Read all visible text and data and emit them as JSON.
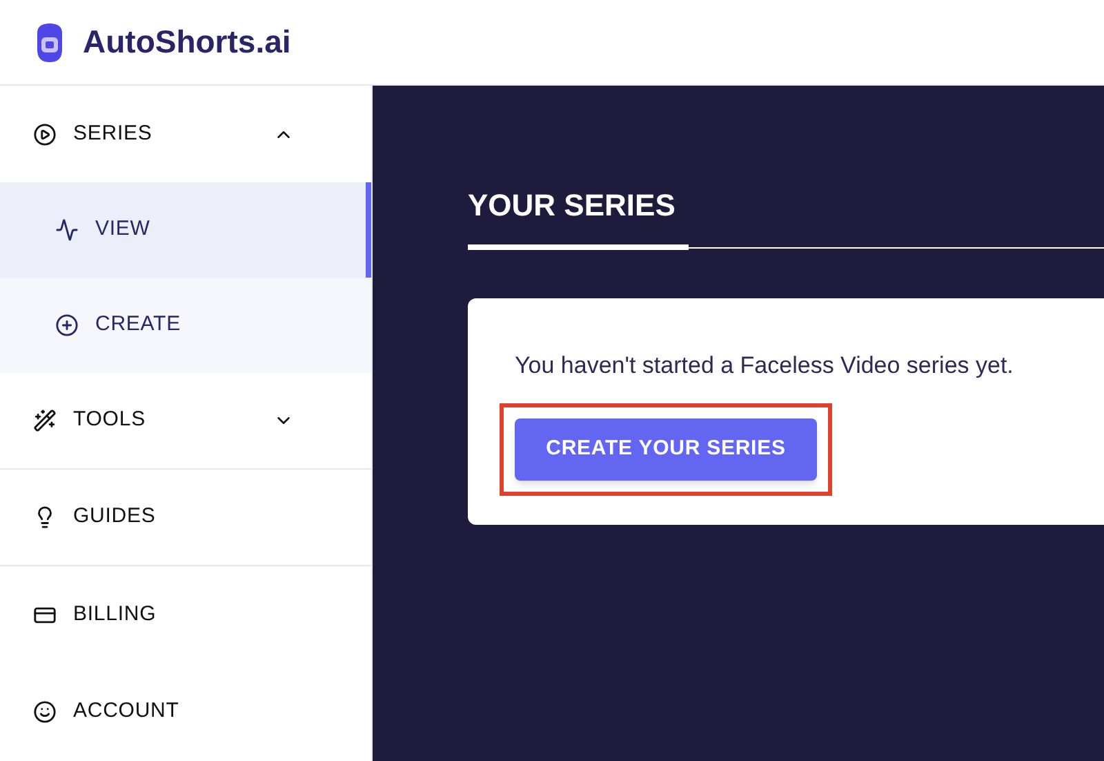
{
  "brand": {
    "name": "AutoShorts.ai"
  },
  "sidebar": {
    "items": [
      {
        "label": "SERIES",
        "expanded": true,
        "children": [
          {
            "label": "VIEW",
            "selected": true
          },
          {
            "label": "CREATE",
            "selected": false
          }
        ]
      },
      {
        "label": "TOOLS",
        "expanded": false
      },
      {
        "label": "GUIDES"
      },
      {
        "label": "BILLING"
      },
      {
        "label": "ACCOUNT"
      }
    ]
  },
  "main": {
    "tab": "YOUR SERIES",
    "message": "You haven't started a Faceless Video series yet.",
    "button": {
      "label": "CREATE YOUR SERIES",
      "highlighted": true
    }
  }
}
